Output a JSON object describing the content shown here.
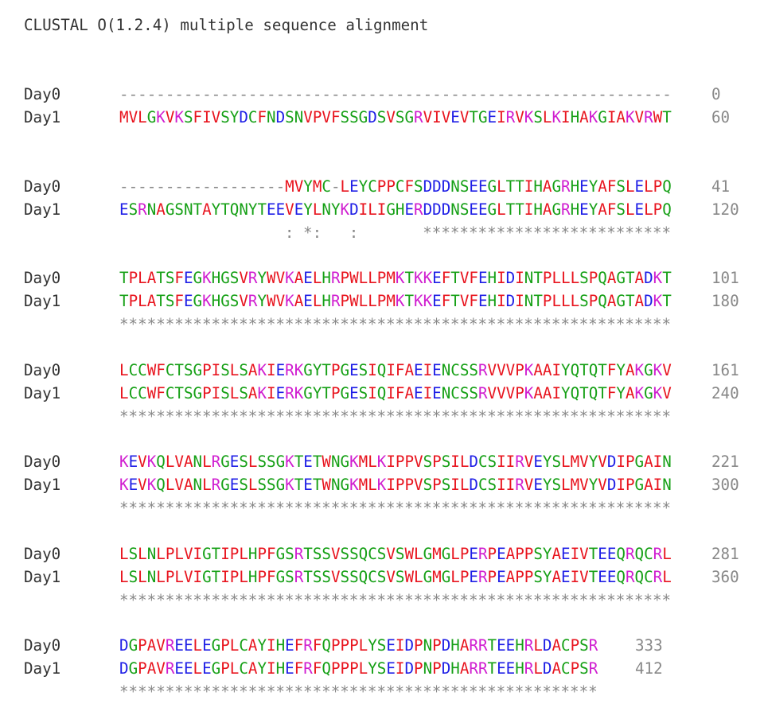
{
  "title": "CLUSTAL O(1.2.4) multiple sequence alignment",
  "colors": {
    "hydrophobic_red": "#e8141e",
    "acidic_blue": "#1e1ee6",
    "basic_magenta": "#d01ed0",
    "polar_green": "#16a016",
    "gap_grey": "#888888"
  },
  "blocks": [
    {
      "rows": [
        {
          "name": "Day0",
          "seq": "------------------------------------------------------------",
          "count": "0"
        },
        {
          "name": "Day1",
          "seq": "MVLGKVKSFIVSYDCFNDSNVPVFSSGDSVSGRVIVEVTGEIRVKSLKIHAKGIAKVRWT",
          "count": "60"
        }
      ],
      "consensus": ""
    },
    {
      "rows": [
        {
          "name": "Day0",
          "seq": "------------------MVYMC-LEYCPPCFSDDDNSEEGLTTIHAGRHEYAFSLELPQ",
          "count": "41"
        },
        {
          "name": "Day1",
          "seq": "ESRNAGSNTAYTQNYTEEVEYLNYKDILIGHERDDDNSEEGLTTIHAGRHEYAFSLELPQ",
          "count": "120"
        }
      ],
      "consensus": "                  : *:   :       ***************************"
    },
    {
      "rows": [
        {
          "name": "Day0",
          "seq": "TPLATSFEGKHGSVRYWVKAELHRPWLLPMKTKKEFTVFEHIDINTPLLLSPQAGTADKT",
          "count": "101"
        },
        {
          "name": "Day1",
          "seq": "TPLATSFEGKHGSVRYWVKAELHRPWLLPMKTKKEFTVFEHIDINTPLLLSPQAGTADKT",
          "count": "180"
        }
      ],
      "consensus": "************************************************************"
    },
    {
      "rows": [
        {
          "name": "Day0",
          "seq": "LCCWFCTSGPISLSAKIERKGYTPGESIQIFAEIENCSSRVVVPKAAIYQTQTFYAKGKV",
          "count": "161"
        },
        {
          "name": "Day1",
          "seq": "LCCWFCTSGPISLSAKIERKGYTPGESIQIFAEIENCSSRVVVPKAAIYQTQTFYAKGKV",
          "count": "240"
        }
      ],
      "consensus": "************************************************************"
    },
    {
      "rows": [
        {
          "name": "Day0",
          "seq": "KEVKQLVANLRGESLSSGKTETWNGKMLKIPPVSPSILDCSIIRVEYSLMVYVDIPGAIN",
          "count": "221"
        },
        {
          "name": "Day1",
          "seq": "KEVKQLVANLRGESLSSGKTETWNGKMLKIPPVSPSILDCSIIRVEYSLMVYVDIPGAIN",
          "count": "300"
        }
      ],
      "consensus": "************************************************************"
    },
    {
      "rows": [
        {
          "name": "Day0",
          "seq": "LSLNLPLVIGTIPLHPFGSRTSSVSSQCSVSWLGMGLPERPEAPPSYAEIVTEEQRQCRL",
          "count": "281"
        },
        {
          "name": "Day1",
          "seq": "LSLNLPLVIGTIPLHPFGSRTSSVSSQCSVSWLGMGLPERPEAPPSYAEIVTEEQRQCRL",
          "count": "360"
        }
      ],
      "consensus": "************************************************************"
    },
    {
      "rows": [
        {
          "name": "Day0",
          "seq": "DGPAVREELEGPLCAYIHEFRFQPPPLYSEIDPNPDHARRTEEHRLDACPSR",
          "count": "333"
        },
        {
          "name": "Day1",
          "seq": "DGPAVREELEGPLCAYIHEFRFQPPPLYSEIDPNPDHARRTEEHRLDACPSR",
          "count": "412"
        }
      ],
      "consensus": "****************************************************"
    }
  ]
}
